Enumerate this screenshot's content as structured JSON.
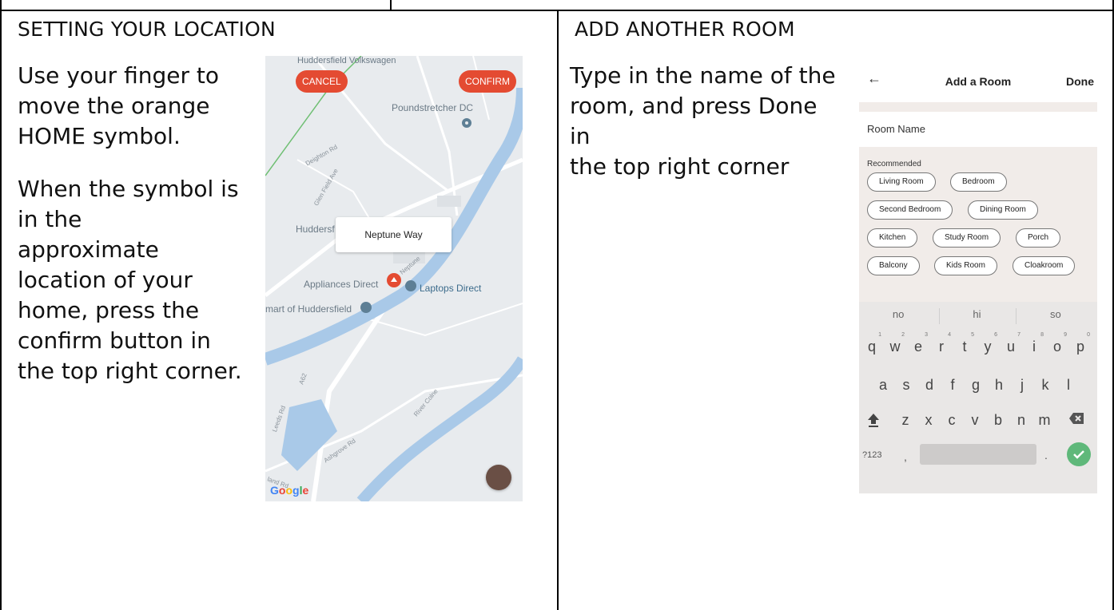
{
  "left_section": {
    "heading": "SETTING YOUR LOCATION",
    "para1_lines": [
      "Use your finger to",
      "move the orange",
      "HOME symbol."
    ],
    "para2_lines": [
      "When the symbol is",
      "in the",
      "approximate",
      "location of your",
      "home, press the",
      "confirm button in",
      "the top right corner."
    ],
    "map": {
      "cancel_label": "CANCEL",
      "confirm_label": "CONFIRM",
      "popup_text": "Neptune Way",
      "places": {
        "top_partial": "Huddersfield Volkswagen",
        "poundstretcher": "Poundstretcher DC",
        "huddersf": "Huddersf",
        "appliances": "Appliances Direct",
        "laptops": "Laptops Direct",
        "smart": "mart of Huddersfield"
      },
      "roads": {
        "deighton": "Deighton Rd",
        "glen_field": "Glen Field Ave",
        "neptune": "Neptune",
        "a62": "A62",
        "leeds": "Leeds Rd",
        "ashgrove": "Ashgrove Rd",
        "land": "land Rd",
        "river": "River Colne"
      },
      "google_letters": [
        "G",
        "o",
        "o",
        "g",
        "l",
        "e"
      ],
      "colors": {
        "accent": "#e44b32",
        "water": "#a9c9e8",
        "land": "#e8ebee"
      }
    }
  },
  "right_section": {
    "heading": "ADD ANOTHER ROOM",
    "instr_lines": [
      "Type in the name of the",
      "room, and press Done",
      "in",
      "the top right corner"
    ],
    "app": {
      "back_glyph": "←",
      "title": "Add a Room",
      "done_label": "Done",
      "name_label": "Room Name",
      "recommended_label": "Recommended",
      "chip_rows": [
        [
          "Living Room",
          "Bedroom"
        ],
        [
          "Second Bedroom",
          "Dining Room"
        ],
        [
          "Kitchen",
          "Study Room",
          "Porch"
        ],
        [
          "Balcony",
          "Kids Room",
          "Cloakroom"
        ]
      ],
      "keyboard": {
        "suggestions": [
          "no",
          "hi",
          "so"
        ],
        "row1": [
          "q",
          "w",
          "e",
          "r",
          "t",
          "y",
          "u",
          "i",
          "o",
          "p"
        ],
        "row1_digits": [
          "1",
          "2",
          "3",
          "4",
          "5",
          "6",
          "7",
          "8",
          "9",
          "0"
        ],
        "row2": [
          "a",
          "s",
          "d",
          "f",
          "g",
          "h",
          "j",
          "k",
          "l"
        ],
        "row3": [
          "z",
          "x",
          "c",
          "v",
          "b",
          "n",
          "m"
        ],
        "sym_label": "?123",
        "comma": ",",
        "period": ".",
        "enter_color": "#5fb87a"
      }
    }
  }
}
